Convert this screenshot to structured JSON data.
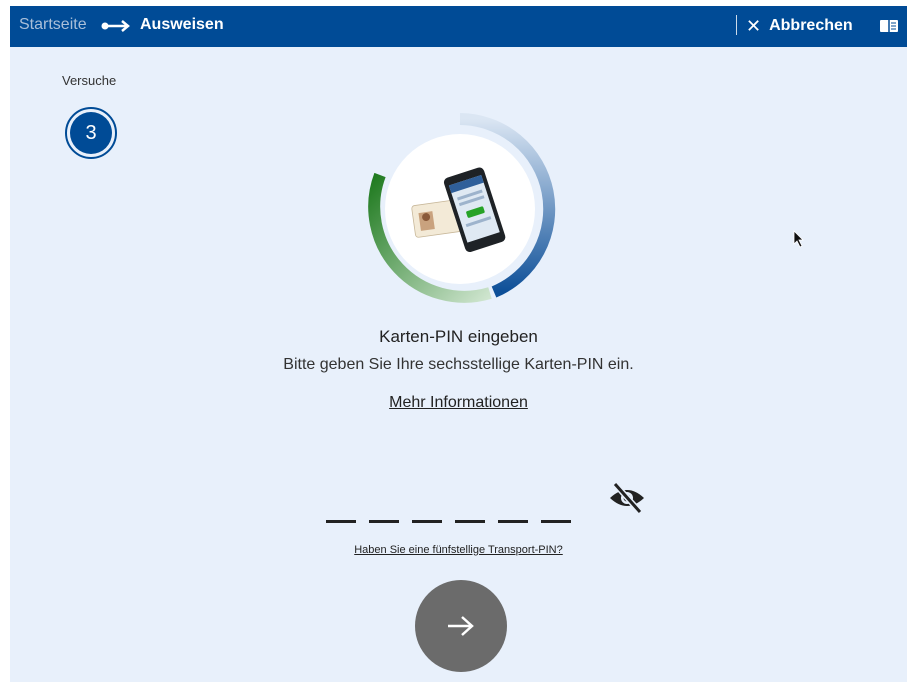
{
  "header": {
    "home_label": "Startseite",
    "current_label": "Ausweisen",
    "cancel_label": "Abbrechen",
    "icons": {
      "separator": "arrow-right-icon",
      "cancel": "close-icon",
      "help": "book-icon"
    },
    "background_color": "#004b96"
  },
  "attempts": {
    "label": "Versuche",
    "count": "3"
  },
  "main": {
    "title": "Karten-PIN eingeben",
    "subtitle": "Bitte geben Sie Ihre sechsstellige Karten-PIN ein.",
    "more_info_link": "Mehr Informationen"
  },
  "pin": {
    "slots": 6,
    "value": "",
    "visibility_icon": "eye-slash-icon",
    "transport_pin_link": "Haben Sie eine fünfstellige Transport-PIN?"
  },
  "submit": {
    "icon": "arrow-right-icon",
    "color": "#6b6b6b"
  },
  "colors": {
    "accent": "#004b96",
    "progress_green": "#2e8b2e",
    "background": "#e8f0fb"
  }
}
